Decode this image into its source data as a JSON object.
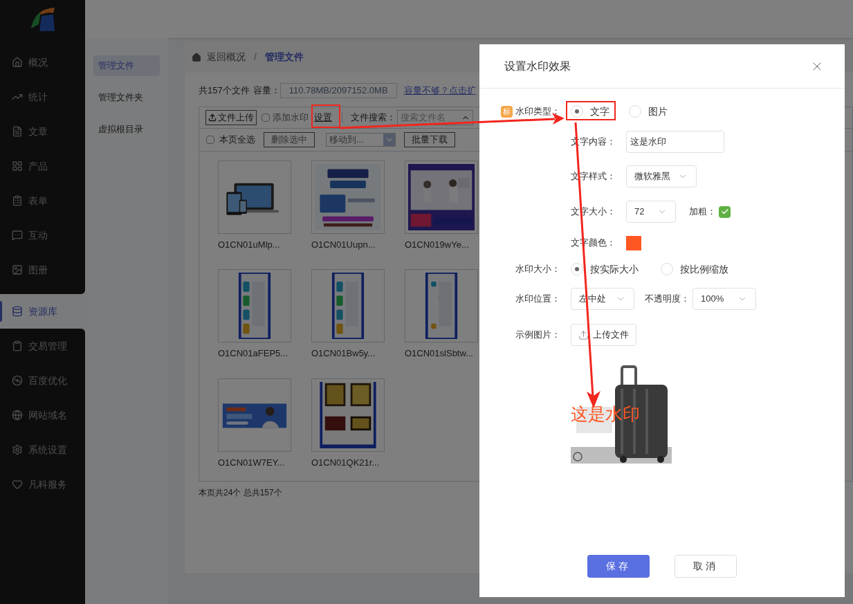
{
  "sidebar": {
    "items": [
      {
        "label": "概况",
        "selected": false
      },
      {
        "label": "统计",
        "selected": false
      },
      {
        "label": "文章",
        "selected": false
      },
      {
        "label": "产品",
        "selected": false
      },
      {
        "label": "表单",
        "selected": false
      },
      {
        "label": "互动",
        "selected": false
      },
      {
        "label": "图册",
        "selected": false
      },
      {
        "label": "资源库",
        "selected": true
      },
      {
        "label": "交易管理",
        "selected": false
      },
      {
        "label": "百度优化",
        "selected": false
      },
      {
        "label": "网站域名",
        "selected": false
      },
      {
        "label": "系统设置",
        "selected": false
      },
      {
        "label": "凡科服务",
        "selected": false
      }
    ]
  },
  "subnav": {
    "items": [
      {
        "label": "管理文件",
        "selected": true
      },
      {
        "label": "管理文件夹",
        "selected": false
      },
      {
        "label": "虚拟根目录",
        "selected": false
      }
    ]
  },
  "breadcrumb": {
    "back": "返回概况",
    "separator": "/",
    "current": "管理文件"
  },
  "summary": {
    "count": "共157个文件",
    "capacity_label": "容量：",
    "capacity": "110.78MB/2097152.0MB",
    "expand_link": "容量不够？点击扩"
  },
  "toolbar": {
    "upload": "文件上传",
    "watermark": {
      "label": "添加水印",
      "checked": false
    },
    "settings_link": "设置",
    "search_label": "文件搜索：",
    "search_placeholder": "搜索文件名"
  },
  "actions": {
    "select_all": {
      "label": "本页全选",
      "checked": false
    },
    "delete": "删除选中",
    "move": "移动到...",
    "download": "批量下载"
  },
  "files": [
    {
      "name": "O1CN01uMlp..."
    },
    {
      "name": "O1CN01Uupn..."
    },
    {
      "name": "O1CN019wYe..."
    },
    {
      "name": "O1CN01aFEP5..."
    },
    {
      "name": "O1CN01Bw5y..."
    },
    {
      "name": "O1CN01slSbtw..."
    },
    {
      "name": "O1CN01W7EY..."
    },
    {
      "name": "O1CN01QK21r..."
    }
  ],
  "footer": "本页共24个 总共157个",
  "dialog": {
    "title": "设置水印效果",
    "type": {
      "badge": "标",
      "label": "水印类型：",
      "options": [
        {
          "label": "文字",
          "selected": true
        },
        {
          "label": "图片",
          "selected": false
        }
      ]
    },
    "text_content": {
      "label": "文字内容：",
      "value": "这是水印"
    },
    "text_style": {
      "label": "文字样式：",
      "value": "微软雅黑"
    },
    "text_size": {
      "label": "文字大小：",
      "value": "72"
    },
    "bold": {
      "label": "加粗：",
      "checked": true
    },
    "text_color": {
      "label": "文字颜色：",
      "color": "#ff5722"
    },
    "size": {
      "label": "水印大小：",
      "options": [
        {
          "label": "按实际大小",
          "selected": true
        },
        {
          "label": "按比例缩放",
          "selected": false
        }
      ]
    },
    "position": {
      "label": "水印位置：",
      "value": "左中处"
    },
    "opacity": {
      "label": "不透明度：",
      "value": "100%"
    },
    "sample": {
      "label": "示例图片：",
      "upload": "上传文件",
      "preview_watermark": "这是水印"
    },
    "buttons": {
      "save": "保存",
      "cancel": "取消"
    }
  }
}
